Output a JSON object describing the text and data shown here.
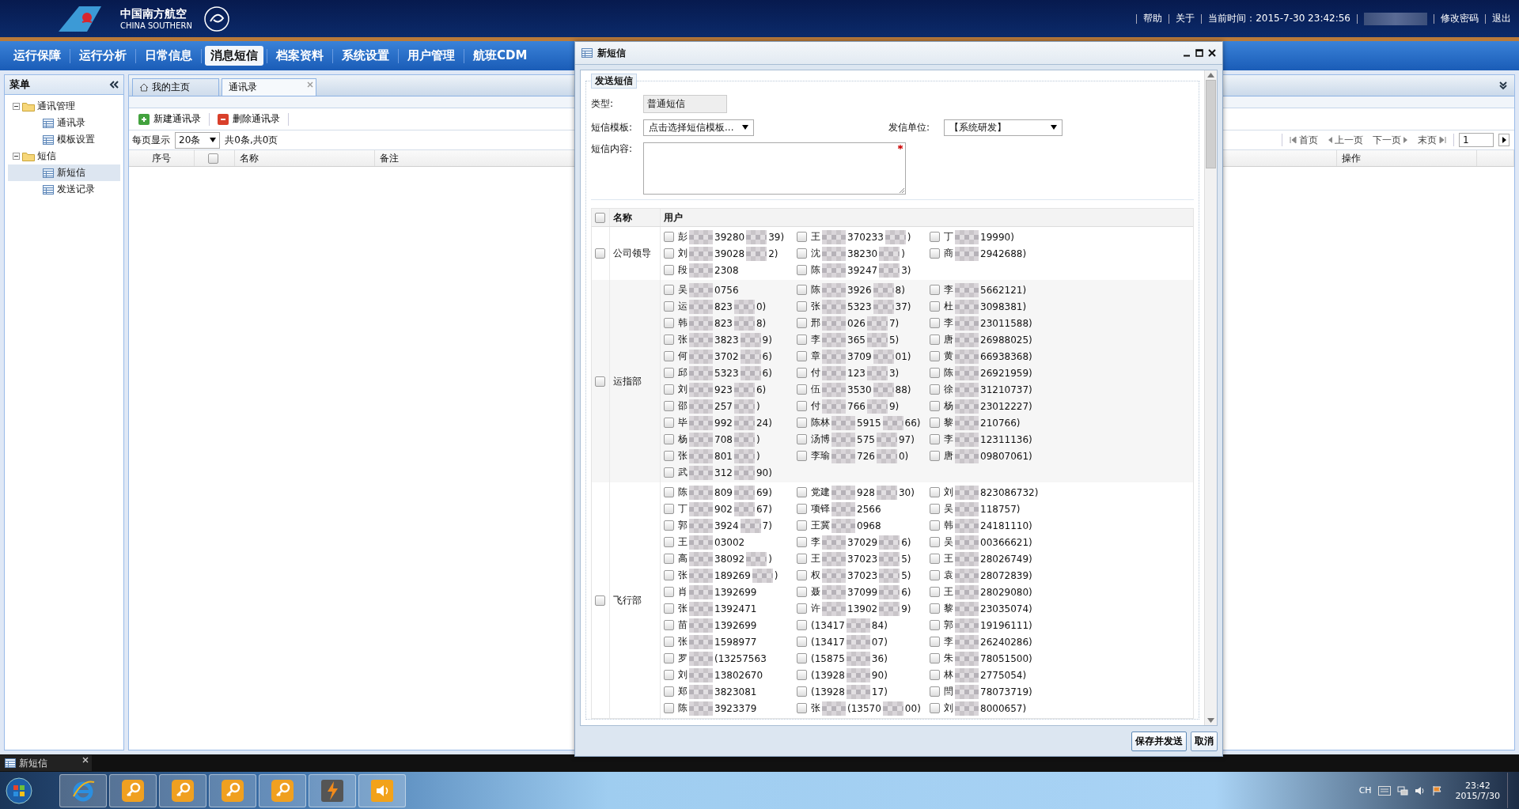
{
  "header": {
    "brand_cn": "中国南方航空",
    "brand_en": "CHINA SOUTHERN",
    "links": [
      {
        "kind": "link",
        "label": "帮助"
      },
      {
        "kind": "link",
        "label": "关于"
      },
      {
        "kind": "text",
        "label": "当前时间：2015-7-30 23:42:56"
      },
      {
        "kind": "redacted"
      },
      {
        "kind": "link",
        "label": "修改密码"
      },
      {
        "kind": "link",
        "label": "退出"
      }
    ]
  },
  "nav": [
    {
      "label": "运行保障",
      "selected": false
    },
    {
      "label": "运行分析",
      "selected": false
    },
    {
      "label": "日常信息",
      "selected": false
    },
    {
      "label": "消息短信",
      "selected": true
    },
    {
      "label": "档案资料",
      "selected": false
    },
    {
      "label": "系统设置",
      "selected": false
    },
    {
      "label": "用户管理",
      "selected": false
    },
    {
      "label": "航班CDM",
      "selected": false
    }
  ],
  "menu": {
    "title": "菜单",
    "tree": [
      {
        "label": "通讯管理",
        "expanded": true,
        "children": [
          {
            "label": "通讯录",
            "selected": false
          },
          {
            "label": "模板设置",
            "selected": false
          }
        ]
      },
      {
        "label": "短信",
        "expanded": true,
        "children": [
          {
            "label": "新短信",
            "selected": true
          },
          {
            "label": "发送记录",
            "selected": false
          }
        ]
      }
    ]
  },
  "tabs": [
    {
      "label": "我的主页",
      "kind": "home",
      "selected": false
    },
    {
      "label": "通讯录",
      "kind": "plain",
      "selected": true
    }
  ],
  "toolbar": [
    {
      "label": "新建通讯录",
      "kind": "add"
    },
    {
      "label": "删除通讯录",
      "kind": "delete"
    }
  ],
  "pager": {
    "per_page_label": "每页显示",
    "per_page": "20条",
    "summary": "共0条,共0页",
    "buttons": [
      {
        "label": "首页",
        "kind": "first"
      },
      {
        "label": "上一页",
        "kind": "prev"
      },
      {
        "label": "下一页",
        "kind": "next"
      },
      {
        "label": "末页",
        "kind": "last"
      }
    ],
    "page": "1"
  },
  "table": {
    "columns": [
      {
        "kind": "text",
        "label": "序号"
      },
      {
        "kind": "checkbox",
        "checked": false
      },
      {
        "kind": "text",
        "label": "名称"
      },
      {
        "kind": "wide",
        "label": "备注"
      },
      {
        "kind": "text",
        "label": "操作"
      }
    ]
  },
  "dialog": {
    "title": "新短信",
    "legend": "发送短信",
    "type_label": "类型:",
    "type_value": "普通短信",
    "template_label": "短信模板:",
    "template_value": "点击选择短信模板...",
    "sender_label": "发信单位:",
    "sender_value": "【系统研发】",
    "content_label": "短信内容:",
    "required": true,
    "list_header": {
      "checked": false,
      "name": "名称",
      "users": "用户"
    },
    "groups": [
      {
        "name": "公司领导",
        "checked": false,
        "users": [
          {
            "parts": [
              "彭",
              "39280",
              "39)"
            ],
            "checked": false
          },
          {
            "parts": [
              "王",
              "370233",
              ")"
            ],
            "checked": false
          },
          {
            "parts": [
              "丁",
              "19990)"
            ],
            "checked": false
          },
          {
            "parts": [
              "刘",
              "39028",
              "2)"
            ],
            "checked": false
          },
          {
            "parts": [
              "沈",
              "38230",
              ")"
            ],
            "checked": false
          },
          {
            "parts": [
              "商",
              "2942688)"
            ],
            "checked": false
          },
          {
            "parts": [
              "段",
              "2308"
            ],
            "checked": false
          },
          {
            "parts": [
              "陈",
              "39247",
              "3)"
            ],
            "checked": false
          }
        ]
      },
      {
        "name": "运指部",
        "checked": false,
        "users": [
          {
            "parts": [
              "吴",
              "0756"
            ],
            "checked": false
          },
          {
            "parts": [
              "陈",
              "3926",
              "8)"
            ],
            "checked": false
          },
          {
            "parts": [
              "李",
              "5662121)"
            ],
            "checked": false
          },
          {
            "parts": [
              "运",
              "823",
              "0)"
            ],
            "checked": false
          },
          {
            "parts": [
              "张",
              "5323",
              "37)"
            ],
            "checked": false
          },
          {
            "parts": [
              "杜",
              "3098381)"
            ],
            "checked": false
          },
          {
            "parts": [
              "韩",
              "823",
              "8)"
            ],
            "checked": false
          },
          {
            "parts": [
              "邢",
              "026",
              "7)"
            ],
            "checked": false
          },
          {
            "parts": [
              "李",
              "23011588)"
            ],
            "checked": false
          },
          {
            "parts": [
              "张",
              "3823",
              "9)"
            ],
            "checked": false
          },
          {
            "parts": [
              "李",
              "365",
              "5)"
            ],
            "checked": false
          },
          {
            "parts": [
              "唐",
              "26988025)"
            ],
            "checked": false
          },
          {
            "parts": [
              "何",
              "3702",
              "6)"
            ],
            "checked": false
          },
          {
            "parts": [
              "章",
              "3709",
              "01)"
            ],
            "checked": false
          },
          {
            "parts": [
              "黄",
              "66938368)"
            ],
            "checked": false
          },
          {
            "parts": [
              "邱",
              "5323",
              "6)"
            ],
            "checked": false
          },
          {
            "parts": [
              "付",
              "123",
              "3)"
            ],
            "checked": false
          },
          {
            "parts": [
              "陈",
              "26921959)"
            ],
            "checked": false
          },
          {
            "parts": [
              "刘",
              "923",
              "6)"
            ],
            "checked": false
          },
          {
            "parts": [
              "伍",
              "3530",
              "88)"
            ],
            "checked": false
          },
          {
            "parts": [
              "徐",
              "31210737)"
            ],
            "checked": false
          },
          {
            "parts": [
              "邵",
              "257",
              ")"
            ],
            "checked": false
          },
          {
            "parts": [
              "付",
              "766",
              "9)"
            ],
            "checked": false
          },
          {
            "parts": [
              "杨",
              "23012227)"
            ],
            "checked": false
          },
          {
            "parts": [
              "毕",
              "992",
              "24)"
            ],
            "checked": false
          },
          {
            "parts": [
              "陈林",
              "5915",
              "66)"
            ],
            "checked": false
          },
          {
            "parts": [
              "黎",
              "210766)"
            ],
            "checked": false
          },
          {
            "parts": [
              "杨",
              "708",
              ")"
            ],
            "checked": false
          },
          {
            "parts": [
              "汤博",
              "575",
              "97)"
            ],
            "checked": false
          },
          {
            "parts": [
              "李",
              "12311136)"
            ],
            "checked": false
          },
          {
            "parts": [
              "张",
              "801",
              ")"
            ],
            "checked": false
          },
          {
            "parts": [
              "李瑜",
              "726",
              "0)"
            ],
            "checked": false
          },
          {
            "parts": [
              "唐",
              "09807061)"
            ],
            "checked": false
          },
          {
            "parts": [
              "武",
              "312",
              "90)"
            ],
            "checked": false
          }
        ]
      },
      {
        "name": "飞行部",
        "checked": false,
        "users": [
          {
            "parts": [
              "陈",
              "809",
              "69)"
            ],
            "checked": false
          },
          {
            "parts": [
              "党建",
              "928",
              "30)"
            ],
            "checked": false
          },
          {
            "parts": [
              "刘",
              "823086732)"
            ],
            "checked": false
          },
          {
            "parts": [
              "丁",
              "902",
              "67)"
            ],
            "checked": false
          },
          {
            "parts": [
              "项铎",
              "2566"
            ],
            "checked": false
          },
          {
            "parts": [
              "吴",
              "118757)"
            ],
            "checked": false
          },
          {
            "parts": [
              "郭",
              "3924",
              "7)"
            ],
            "checked": false
          },
          {
            "parts": [
              "王冀",
              "0968"
            ],
            "checked": false
          },
          {
            "parts": [
              "韩",
              "24181110)"
            ],
            "checked": false
          },
          {
            "parts": [
              "王",
              "03002"
            ],
            "checked": false
          },
          {
            "parts": [
              "李",
              "37029",
              "6)"
            ],
            "checked": false
          },
          {
            "parts": [
              "吴",
              "00366621)"
            ],
            "checked": false
          },
          {
            "parts": [
              "高",
              "38092",
              ")"
            ],
            "checked": false
          },
          {
            "parts": [
              "王",
              "37023",
              "5)"
            ],
            "checked": false
          },
          {
            "parts": [
              "王",
              "28026749)"
            ],
            "checked": false
          },
          {
            "parts": [
              "张",
              "189269",
              ")"
            ],
            "checked": false
          },
          {
            "parts": [
              "权",
              "37023",
              "5)"
            ],
            "checked": false
          },
          {
            "parts": [
              "袁",
              "28072839)"
            ],
            "checked": false
          },
          {
            "parts": [
              "肖",
              "1392699"
            ],
            "checked": false
          },
          {
            "parts": [
              "聂",
              "37099",
              "6)"
            ],
            "checked": false
          },
          {
            "parts": [
              "王",
              "28029080)"
            ],
            "checked": false
          },
          {
            "parts": [
              "张",
              "1392471"
            ],
            "checked": false
          },
          {
            "parts": [
              "许",
              "13902",
              "9)"
            ],
            "checked": false
          },
          {
            "parts": [
              "黎",
              "23035074)"
            ],
            "checked": false
          },
          {
            "parts": [
              "苗",
              "1392699"
            ],
            "checked": false
          },
          {
            "parts": [
              "(13417",
              "84)"
            ],
            "checked": false
          },
          {
            "parts": [
              "郭",
              "19196111)"
            ],
            "checked": false
          },
          {
            "parts": [
              "张",
              "1598977"
            ],
            "checked": false
          },
          {
            "parts": [
              "(13417",
              "07)"
            ],
            "checked": false
          },
          {
            "parts": [
              "李",
              "26240286)"
            ],
            "checked": false
          },
          {
            "parts": [
              "罗",
              "(13257563"
            ],
            "checked": false
          },
          {
            "parts": [
              "(15875",
              "36)"
            ],
            "checked": false
          },
          {
            "parts": [
              "朱",
              "78051500)"
            ],
            "checked": false
          },
          {
            "parts": [
              "刘",
              "13802670"
            ],
            "checked": false
          },
          {
            "parts": [
              "(13928",
              "90)"
            ],
            "checked": false
          },
          {
            "parts": [
              "林",
              "2775054)"
            ],
            "checked": false
          },
          {
            "parts": [
              "郑",
              "3823081"
            ],
            "checked": false
          },
          {
            "parts": [
              "(13928",
              "17)"
            ],
            "checked": false
          },
          {
            "parts": [
              "閆",
              "78073719)"
            ],
            "checked": false
          },
          {
            "parts": [
              "陈",
              "3923379"
            ],
            "checked": false
          },
          {
            "parts": [
              "张",
              "(13570",
              "00)"
            ],
            "checked": false
          },
          {
            "parts": [
              "刘",
              "8000657)"
            ],
            "checked": false
          }
        ]
      }
    ],
    "buttons": [
      {
        "label": "保存并发送",
        "kind": "primary"
      },
      {
        "label": "取消",
        "kind": "secondary"
      }
    ]
  },
  "minimized": {
    "label": "新短信"
  },
  "taskbar": {
    "apps": [
      {
        "kind": "ie"
      },
      {
        "kind": "key"
      },
      {
        "kind": "key"
      },
      {
        "kind": "key"
      },
      {
        "kind": "key"
      },
      {
        "kind": "bolt"
      },
      {
        "kind": "speaker"
      }
    ],
    "lang": "CH",
    "time": "23:42",
    "date": "2015/7/30"
  }
}
